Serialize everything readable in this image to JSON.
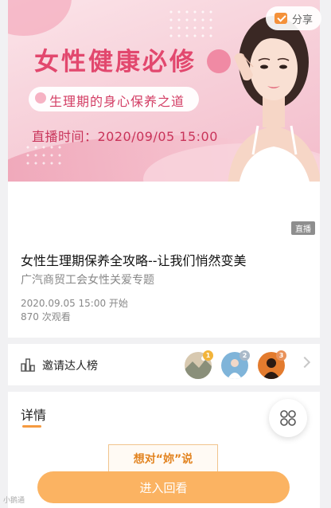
{
  "banner": {
    "title": "女性健康必修",
    "subtitle": "生理期的身心保养之道",
    "time": "直播时间：2020/09/05 15:00"
  },
  "share": {
    "label": "分享",
    "icon": "share-icon",
    "icon_color": "#f4913a"
  },
  "live_tag": "直播",
  "info": {
    "title": "女性生理期保养全攻略--让我们悄然变美",
    "subtitle": "广汽商贸工会女性关爱专题",
    "start": "2020.09.05 15:00 开始",
    "views": "870 次观看"
  },
  "rank": {
    "label": "邀请达人榜",
    "icon": "ranking-bars-icon",
    "badges": [
      "1",
      "2",
      "3"
    ],
    "badge_colors": [
      "#f2b43a",
      "#a9b9c9",
      "#e9925a"
    ]
  },
  "details": {
    "title": "详情",
    "poster_text": "想对“妳”说"
  },
  "float_button": {
    "icon": "grid-menu-icon"
  },
  "replay_button": {
    "label": "进入回看"
  },
  "watermark": "小鹅通",
  "colors": {
    "accent": "#f59a40",
    "button": "#fbb362",
    "banner_pink": "#e2486e"
  }
}
